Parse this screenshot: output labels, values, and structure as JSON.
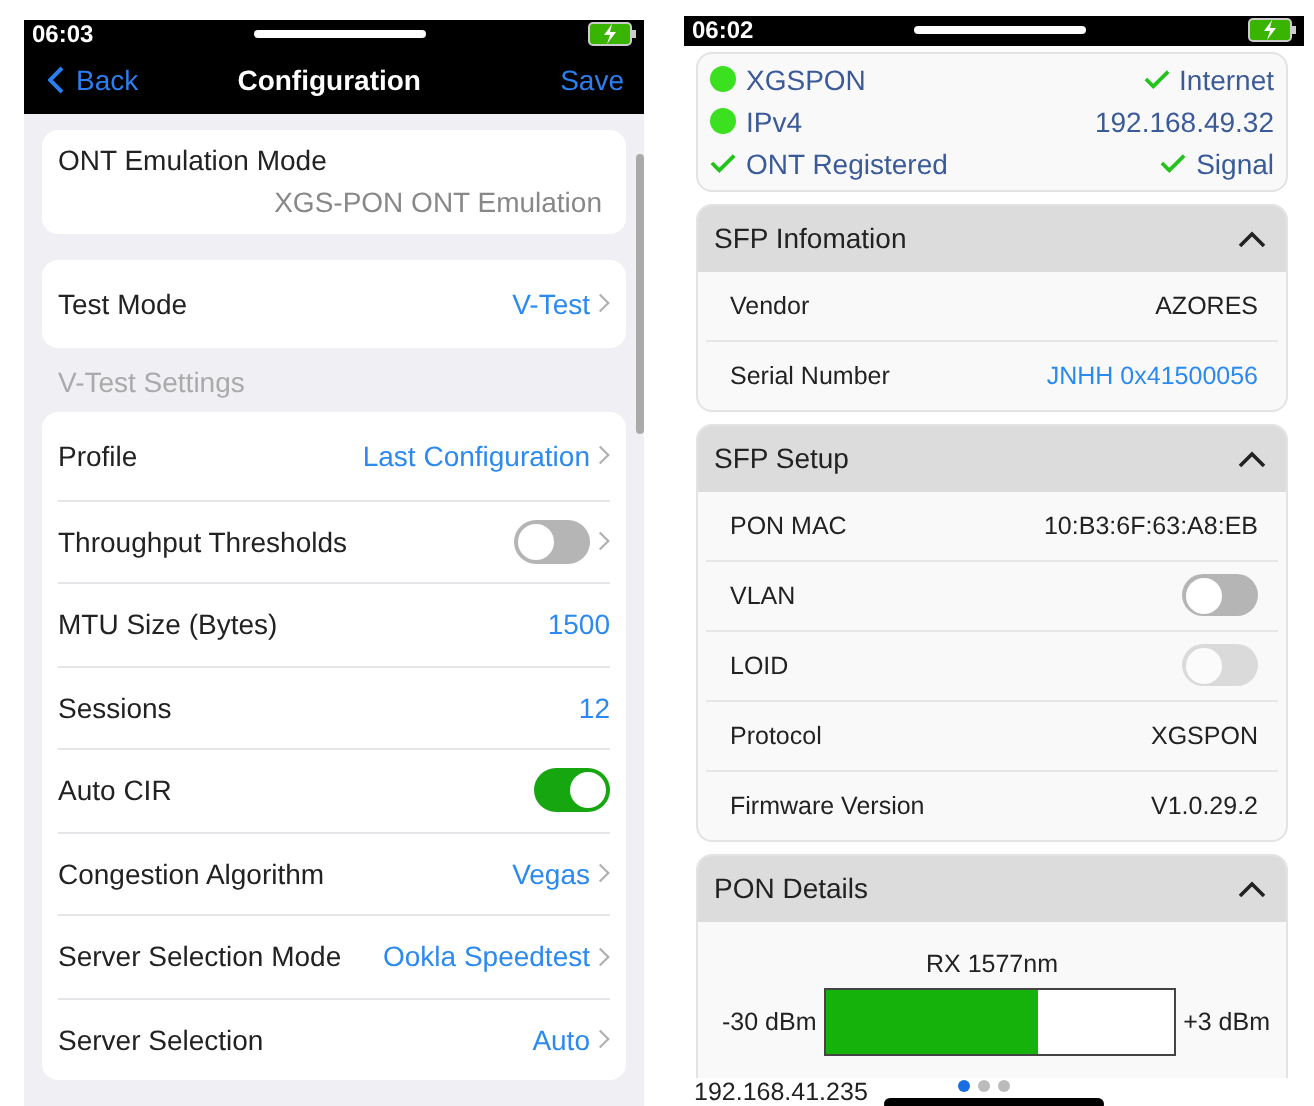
{
  "left_phone": {
    "status_bar": {
      "time": "06:03"
    },
    "nav_bar": {
      "back": "Back",
      "title": "Configuration",
      "save": "Save"
    },
    "emulation": {
      "label": "ONT Emulation Mode",
      "value": "XGS-PON ONT Emulation"
    },
    "test_mode": {
      "label": "Test Mode",
      "value": "V-Test"
    },
    "section_header": "V-Test Settings",
    "settings": [
      {
        "kind": "link",
        "label": "Profile",
        "value": "Last Configuration"
      },
      {
        "kind": "toggle_link",
        "label": "Throughput Thresholds",
        "on": false
      },
      {
        "kind": "value",
        "label": "MTU Size (Bytes)",
        "value": "1500"
      },
      {
        "kind": "value",
        "label": "Sessions",
        "value": "12"
      },
      {
        "kind": "toggle",
        "label": "Auto CIR",
        "on": true
      },
      {
        "kind": "link",
        "label": "Congestion Algorithm",
        "value": "Vegas"
      },
      {
        "kind": "link",
        "label": "Server Selection Mode",
        "value": "Ookla Speedtest"
      },
      {
        "kind": "link",
        "label": "Server Selection",
        "value": "Auto"
      }
    ]
  },
  "right_phone": {
    "status_bar": {
      "time": "06:02"
    },
    "status_card": [
      {
        "left": {
          "kind": "dot",
          "text": "XGSPON"
        },
        "right": {
          "kind": "check",
          "text": "Internet"
        }
      },
      {
        "left": {
          "kind": "dot",
          "text": "IPv4"
        },
        "right": {
          "kind": "plain",
          "text": "192.168.49.32"
        }
      },
      {
        "left": {
          "kind": "check",
          "text": "ONT Registered"
        },
        "right": {
          "kind": "check",
          "text": "Signal"
        }
      }
    ],
    "sections": [
      {
        "title": "SFP Infomation",
        "expanded": true,
        "rows": [
          {
            "kind": "text",
            "label": "Vendor",
            "value": "AZORES"
          },
          {
            "kind": "link",
            "label": "Serial Number",
            "value": "JNHH 0x41500056"
          }
        ]
      },
      {
        "title": "SFP Setup",
        "expanded": true,
        "rows": [
          {
            "kind": "text",
            "label": "PON MAC",
            "value": "10:B3:6F:63:A8:EB"
          },
          {
            "kind": "toggle",
            "label": "VLAN",
            "on": false,
            "disabled": false
          },
          {
            "kind": "toggle",
            "label": "LOID",
            "on": false,
            "disabled": true
          },
          {
            "kind": "text",
            "label": "Protocol",
            "value": "XGSPON"
          },
          {
            "kind": "text",
            "label": "Firmware Version",
            "value": "V1.0.29.2"
          }
        ]
      }
    ],
    "pon_details": {
      "title": "PON Details",
      "expanded": true,
      "meter_title": "RX 1577nm",
      "min": "-30 dBm",
      "max": "+3 dBm",
      "level": 0.61
    },
    "footer": {
      "ip": "192.168.41.235",
      "pages": [
        {
          "selected": true
        },
        {
          "selected": false
        },
        {
          "selected": false
        }
      ]
    }
  }
}
